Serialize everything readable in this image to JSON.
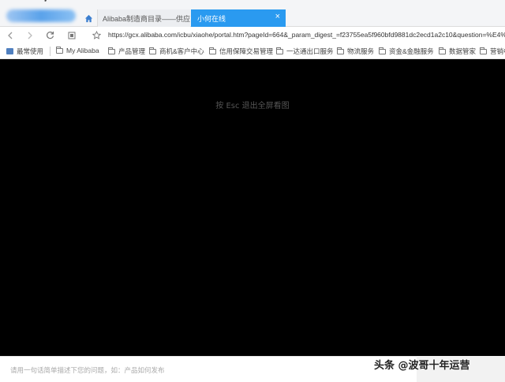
{
  "tabs": [
    {
      "label": "Alibaba制造商目录——供应商"
    },
    {
      "label": "小何在线",
      "close": "×"
    }
  ],
  "address_bar": {
    "url": "https://gcx.alibaba.com/icbu/xiaohe/portal.htm?pageId=664&_param_digest_=f23755ea5f960bfd9881dc2ecd1a2c10&question=%E4%"
  },
  "bookmarks": [
    "最常使用",
    "My Alibaba",
    "产品管理",
    "商机&客户中心",
    "信用保障交易管理",
    "一达通出口服务",
    "物流服务",
    "资金&金融服务",
    "数据管家",
    "营销中"
  ],
  "overlay": {
    "esc_hint": "按 Esc 退出全屏看图"
  },
  "chat_input": {
    "placeholder": "请用一句话简单描述下您的问题，如：产品如何发布"
  },
  "watermark": "头条 @波哥十年运营",
  "colors": {
    "active_tab": "#2a9af0",
    "viewport": "#000000"
  }
}
